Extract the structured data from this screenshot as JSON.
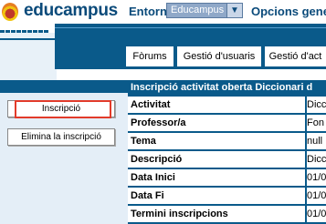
{
  "header": {
    "logo_text": "educampus",
    "menu_entorn": "Entorn",
    "select_value": "Educampus",
    "select_arrow": "▼",
    "menu_opcions": "Opcions gener"
  },
  "tabs": [
    {
      "label": "Fòrums"
    },
    {
      "label": "Gestió d'usuaris"
    },
    {
      "label": "Gestió d'act"
    }
  ],
  "sidebar": {
    "inscripcio_label": "Inscripció",
    "elimina_label": "Elimina la inscripció"
  },
  "detail": {
    "title": "Inscripció activitat oberta Diccionari d",
    "rows": [
      {
        "label": "Activitat",
        "value": "Dicc"
      },
      {
        "label": "Professor/a",
        "value": "Fon"
      },
      {
        "label": "Tema",
        "value": "null"
      },
      {
        "label": "Descripció",
        "value": "Dicc"
      },
      {
        "label": "Data Inici",
        "value": "01/0"
      },
      {
        "label": "Data Fi",
        "value": "01/0"
      },
      {
        "label": "Termini inscripcions",
        "value": "01/0"
      }
    ]
  }
}
